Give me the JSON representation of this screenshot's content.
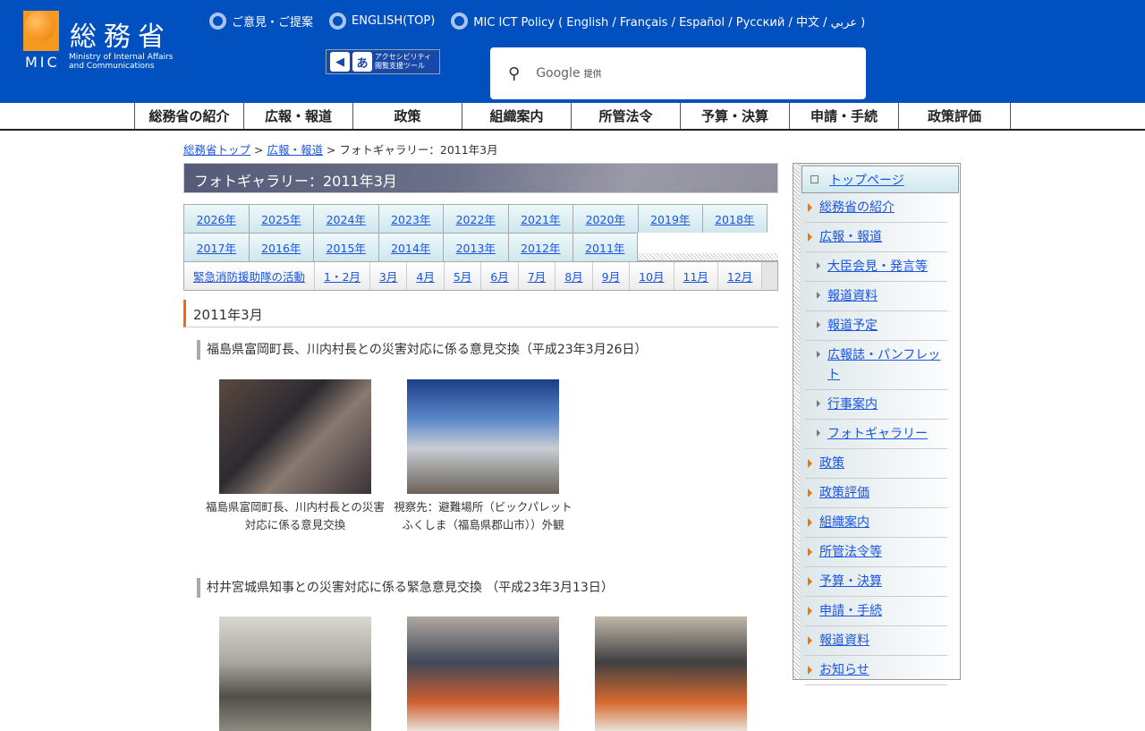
{
  "header": {
    "logo_kanji": "総務省",
    "logo_abbr": "MIC",
    "logo_en": [
      "Ministry of Internal Affairs",
      "and Communications"
    ],
    "links": [
      "ご意見・ご提案",
      "ENGLISH(TOP)",
      "MIC ICT Policy ( English / Français / Español / Русский / 中文 / عربي )"
    ],
    "accessibility": [
      "アクセシビリティ",
      "閲覧支援ツール"
    ],
    "search": {
      "brand": "Google",
      "suffix": "提供"
    }
  },
  "nav": [
    "総務省の紹介",
    "広報・報道",
    "政策",
    "組織案内",
    "所管法令",
    "予算・決算",
    "申請・手続",
    "政策評価"
  ],
  "breadcrumb": {
    "items": [
      "総務省トップ",
      "広報・報道"
    ],
    "current": "フォトギャラリー：2011年3月",
    "sep": " > "
  },
  "page_title": "フォトギャラリー：2011年3月",
  "years_row1": [
    "2026年",
    "2025年",
    "2024年",
    "2023年",
    "2022年",
    "2021年",
    "2020年",
    "2019年",
    "2018年"
  ],
  "years_row2": [
    "2017年",
    "2016年",
    "2015年",
    "2014年",
    "2013年",
    "2012年",
    "2011年"
  ],
  "months": [
    "緊急消防援助隊の活動",
    "1・2月",
    "3月",
    "4月",
    "5月",
    "6月",
    "7月",
    "8月",
    "9月",
    "10月",
    "11月",
    "12月"
  ],
  "section": "2011年3月",
  "events": [
    {
      "title": "福島県富岡町長、川内村長との災害対応に係る意見交換（平成23年3月26日）",
      "captions": [
        "福島県富岡町長、川内村長との災害対応に係る意見交換",
        "視察先：避難場所（ビックパレットふくしま（福島県郡山市））外観"
      ]
    },
    {
      "title": "村井宮城県知事との災害対応に係る緊急意見交換 （平成23年3月13日）"
    }
  ],
  "sidebar": {
    "top": "トップページ",
    "items": [
      {
        "label": "総務省の紹介"
      },
      {
        "label": "広報・報道"
      },
      {
        "label": "大臣会見・発言等",
        "sub": true
      },
      {
        "label": "報道資料",
        "sub": true
      },
      {
        "label": "報道予定",
        "sub": true
      },
      {
        "label": "広報誌・パンフレット",
        "sub": true
      },
      {
        "label": "行事案内",
        "sub": true
      },
      {
        "label": "フォトギャラリー",
        "sub": true
      },
      {
        "label": "政策"
      },
      {
        "label": "政策評価"
      },
      {
        "label": "組織案内"
      },
      {
        "label": "所管法令等"
      },
      {
        "label": "予算・決算"
      },
      {
        "label": "申請・手続"
      },
      {
        "label": "報道資料"
      },
      {
        "label": "お知らせ"
      }
    ]
  }
}
